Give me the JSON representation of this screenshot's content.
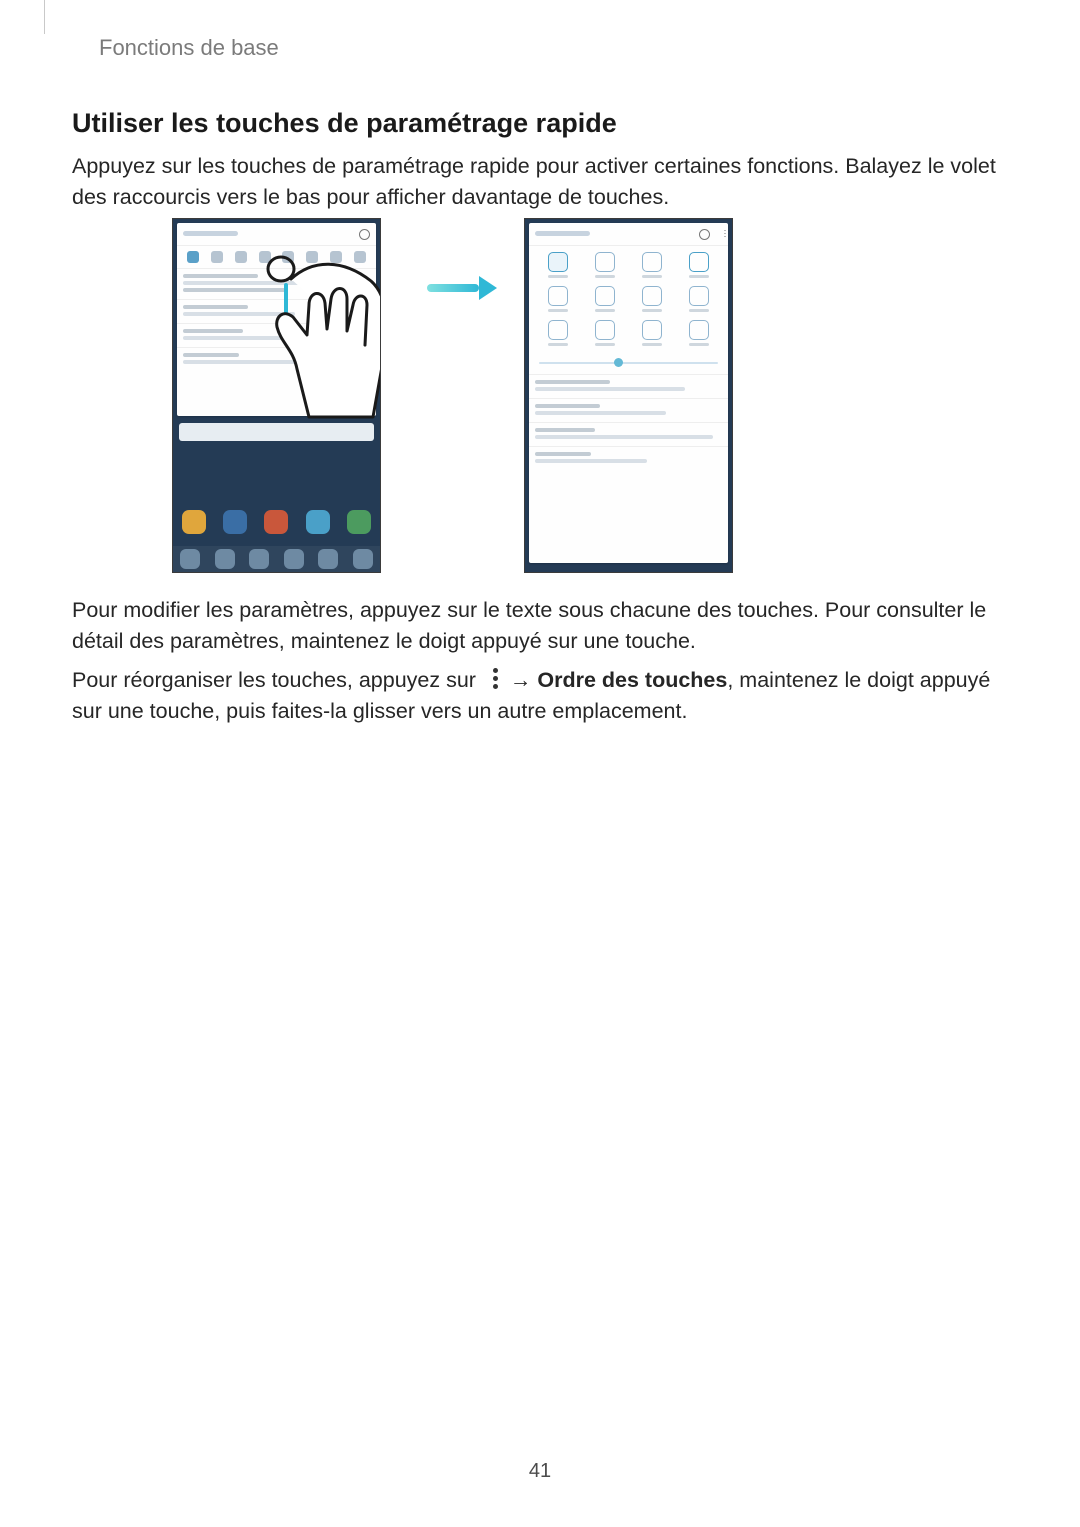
{
  "breadcrumb": "Fonctions de base",
  "section_title": "Utiliser les touches de paramétrage rapide",
  "intro": "Appuyez sur les touches de paramétrage rapide pour activer certaines fonctions. Balayez le volet des raccourcis vers le bas pour afficher davantage de touches.",
  "after_figure": "Pour modifier les paramètres, appuyez sur le texte sous chacune des touches. Pour consulter le détail des paramètres, maintenez le doigt appuyé sur une touche.",
  "reorder_pre": "Pour réorganiser les touches, appuyez sur ",
  "reorder_arrow": " → ",
  "reorder_bold": "Ordre des touches",
  "reorder_post": ", maintenez le doigt appuyé sur une touche, puis faites-la glisser vers un autre emplacement.",
  "page_number": "41",
  "icons": {
    "more": "more-vertical-icon"
  }
}
